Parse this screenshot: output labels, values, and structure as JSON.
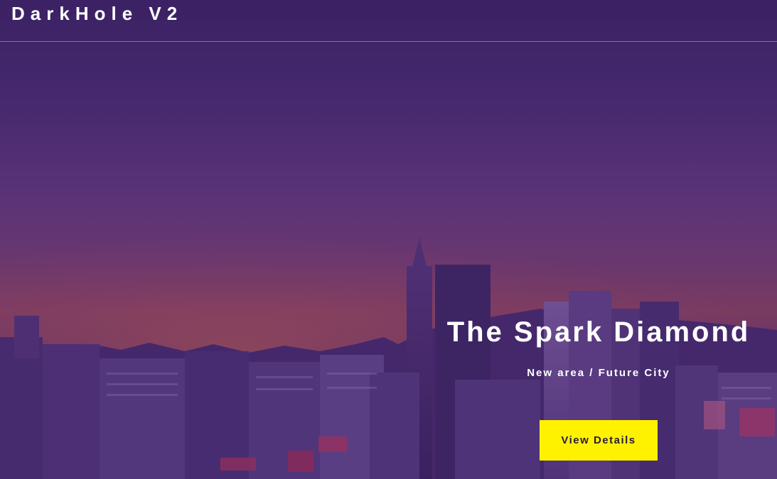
{
  "header": {
    "logo": "DarkHole V2"
  },
  "hero": {
    "title": "The Spark Diamond",
    "subtitle": "New area / Future City",
    "cta_label": "View Details",
    "accent_color": "#fff200"
  }
}
